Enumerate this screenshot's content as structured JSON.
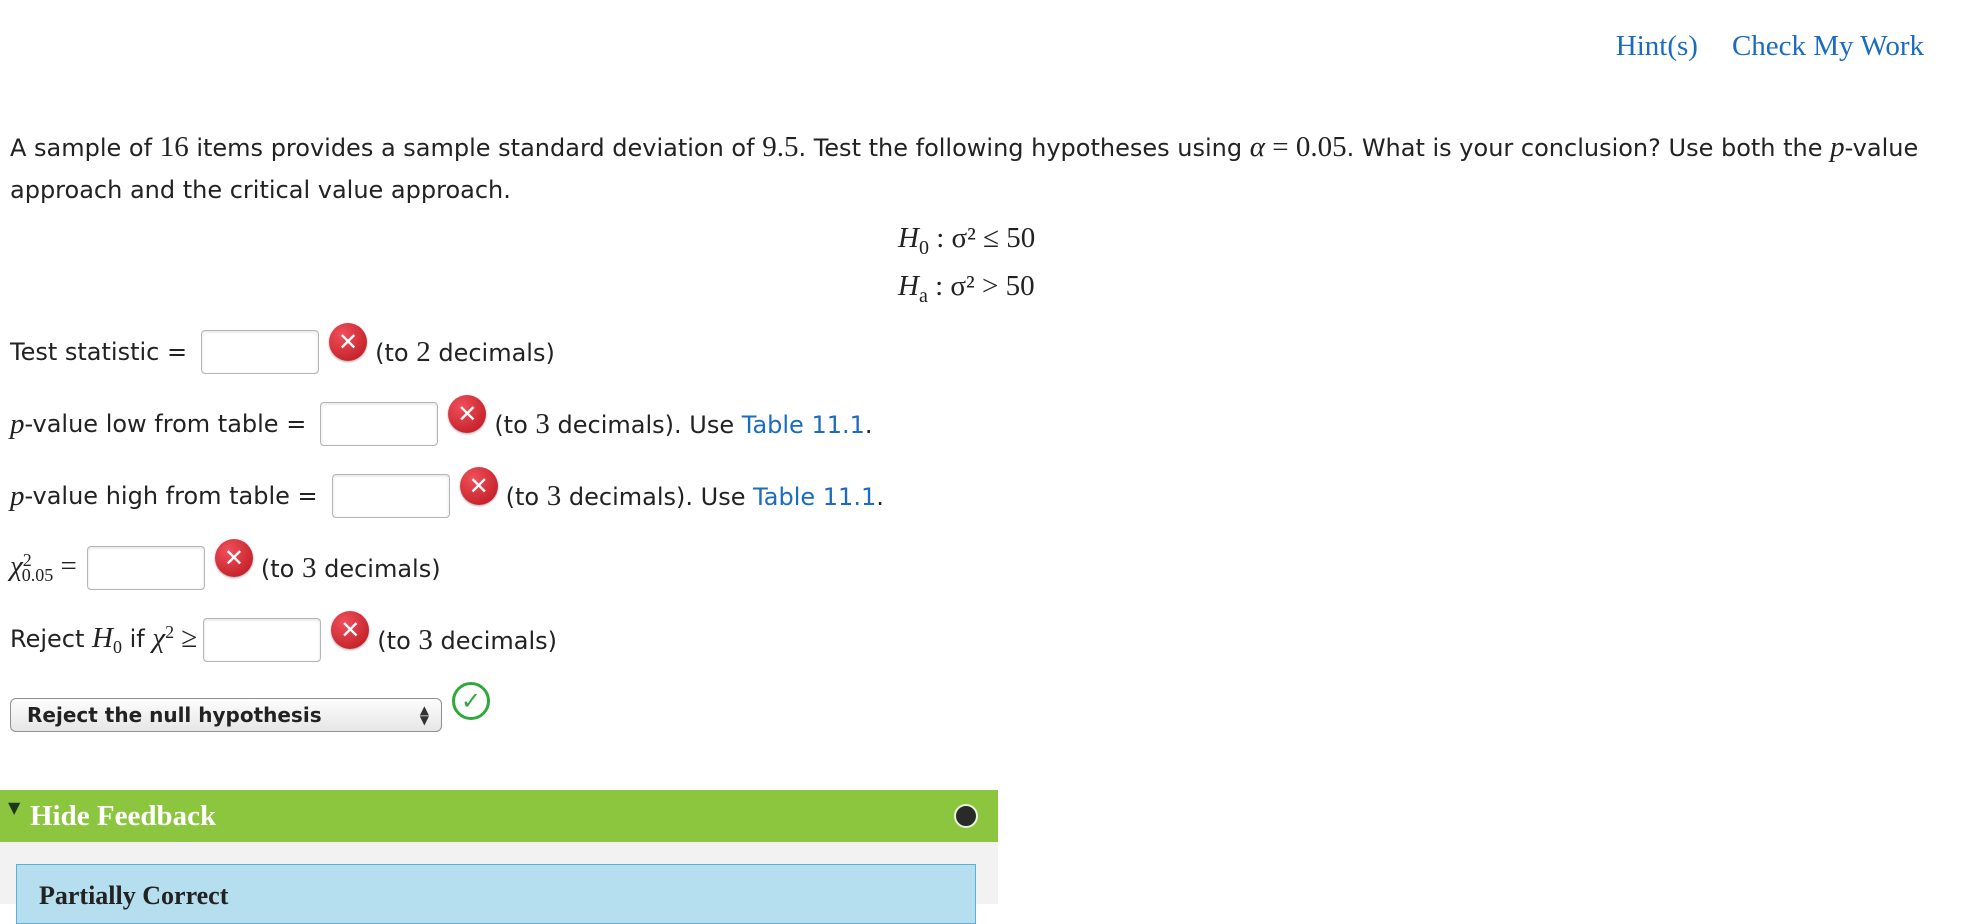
{
  "header": {
    "hints_label": "Hint(s)",
    "check_label": "Check My Work"
  },
  "question": {
    "t1": "A sample of ",
    "n": "16",
    "t2": " items provides a sample standard deviation of ",
    "s": "9.5",
    "t3": ". Test the following hypotheses using ",
    "alpha_sym": "α",
    "eq": " = ",
    "alpha": "0.05",
    "t4": ". What is your conclusion? Use both the ",
    "p": "p",
    "t5": "-value approach and the critical value approach."
  },
  "hypotheses": {
    "h0": "H",
    "h0_sub": "0",
    "h0_rest": " :  σ² ≤ 50",
    "ha": "H",
    "ha_sub": "a",
    "ha_rest": " :  σ² > 50"
  },
  "rows": {
    "test_stat": {
      "label": "Test statistic =",
      "note_a": "(to ",
      "num": "2",
      "note_b": " decimals)"
    },
    "p_low": {
      "p": "p",
      "label": "-value low from table =",
      "note_a": "(to ",
      "num": "3",
      "note_b": " decimals). Use ",
      "link": "Table 11.1",
      "end": "."
    },
    "p_high": {
      "p": "p",
      "label": "-value high from table =",
      "note_a": "(to ",
      "num": "3",
      "note_b": " decimals). Use ",
      "link": "Table 11.1",
      "end": "."
    },
    "chi_crit": {
      "sym": "χ",
      "sup": "2",
      "sub": "0.05",
      "eq": " =",
      "note_a": "(to ",
      "num": "3",
      "note_b": " decimals)"
    },
    "reject_rule": {
      "label": "Reject ",
      "h": "H",
      "h_sub": "0",
      "if": " if ",
      "chi": "χ",
      "sup": "2",
      "ge": " ≥",
      "note_a": "(to ",
      "num": "3",
      "note_b": " decimals)"
    }
  },
  "conclusion": {
    "selected": "Reject the null hypothesis"
  },
  "feedback": {
    "toggle_label": "Hide Feedback",
    "status": "Partially Correct"
  },
  "colors": {
    "link": "#1a6bc2",
    "feedback_header": "#8cc63f",
    "feedback_panel": "#b5deee",
    "error": "#d71f27",
    "correct": "#2fa83c"
  }
}
